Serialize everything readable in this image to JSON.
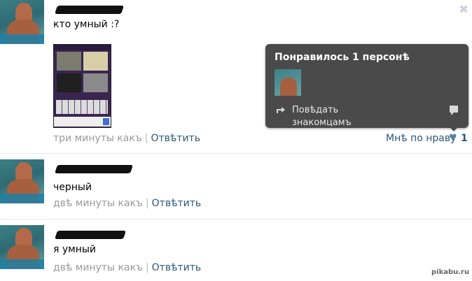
{
  "comments": [
    {
      "text": "кто умный :?",
      "time": "три минуты какъ",
      "reply": "Отвѣтить"
    },
    {
      "text": "черный",
      "time": "двѣ минуты какъ",
      "reply": "Отвѣтить"
    },
    {
      "text": "я умный",
      "time": "двѣ минуты какъ",
      "reply": "Отвѣтить"
    }
  ],
  "like": {
    "label": "Мнѣ по нраву",
    "count": "1"
  },
  "tooltip": {
    "title": "Понравилось 1 персонѣ",
    "share_label": "Повѣдать знакомцамъ"
  },
  "watermark": "pikabu.ru",
  "icons": {
    "close": "close-icon",
    "heart": "heart-icon",
    "share": "share-icon",
    "message": "message-icon"
  }
}
